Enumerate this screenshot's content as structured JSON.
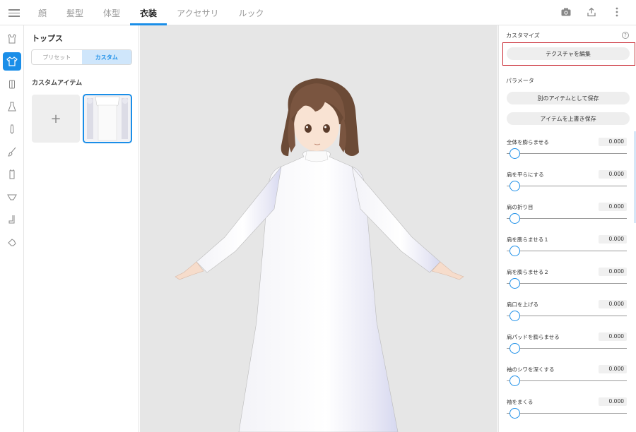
{
  "topbar": {
    "tabs": [
      "顔",
      "髪型",
      "体型",
      "衣装",
      "アクセサリ",
      "ルック"
    ],
    "active_tab": "衣装",
    "icons": [
      "camera-icon",
      "share-icon",
      "more-vert-icon"
    ]
  },
  "rail": {
    "icons": [
      "tank-top-icon",
      "shirt-icon",
      "vest-icon",
      "dress-icon",
      "tie-icon",
      "brush-icon",
      "skirt-icon",
      "underwear-icon",
      "sock-icon",
      "shoe-icon"
    ],
    "active_index": 1
  },
  "panel": {
    "title": "トップス",
    "segment": {
      "preset": "プリセット",
      "custom": "カスタム",
      "active": "カスタム"
    },
    "section_label": "カスタムアイテム",
    "add_symbol": "+"
  },
  "right": {
    "customize_title": "カスタマイズ",
    "help_symbol": "?",
    "edit_texture": "テクスチャを編集",
    "params_title": "パラメータ",
    "save_as_new": "別のアイテムとして保存",
    "overwrite_save": "アイテムを上書き保存",
    "params": [
      {
        "label": "全体を膨らませる",
        "value": "0.000"
      },
      {
        "label": "肩を平らにする",
        "value": "0.000"
      },
      {
        "label": "肩の折り目",
        "value": "0.000"
      },
      {
        "label": "肩を膨らませる１",
        "value": "0.000"
      },
      {
        "label": "肩を膨らませる２",
        "value": "0.000"
      },
      {
        "label": "肩口を上げる",
        "value": "0.000"
      },
      {
        "label": "肩パッドを膨らませる",
        "value": "0.000"
      },
      {
        "label": "袖のシワを深くする",
        "value": "0.000"
      },
      {
        "label": "袖をまくる",
        "value": "0.000"
      }
    ]
  },
  "colors": {
    "accent": "#1a8ee8",
    "highlight": "#c8232c",
    "viewport_bg": "#e6e6e6"
  }
}
